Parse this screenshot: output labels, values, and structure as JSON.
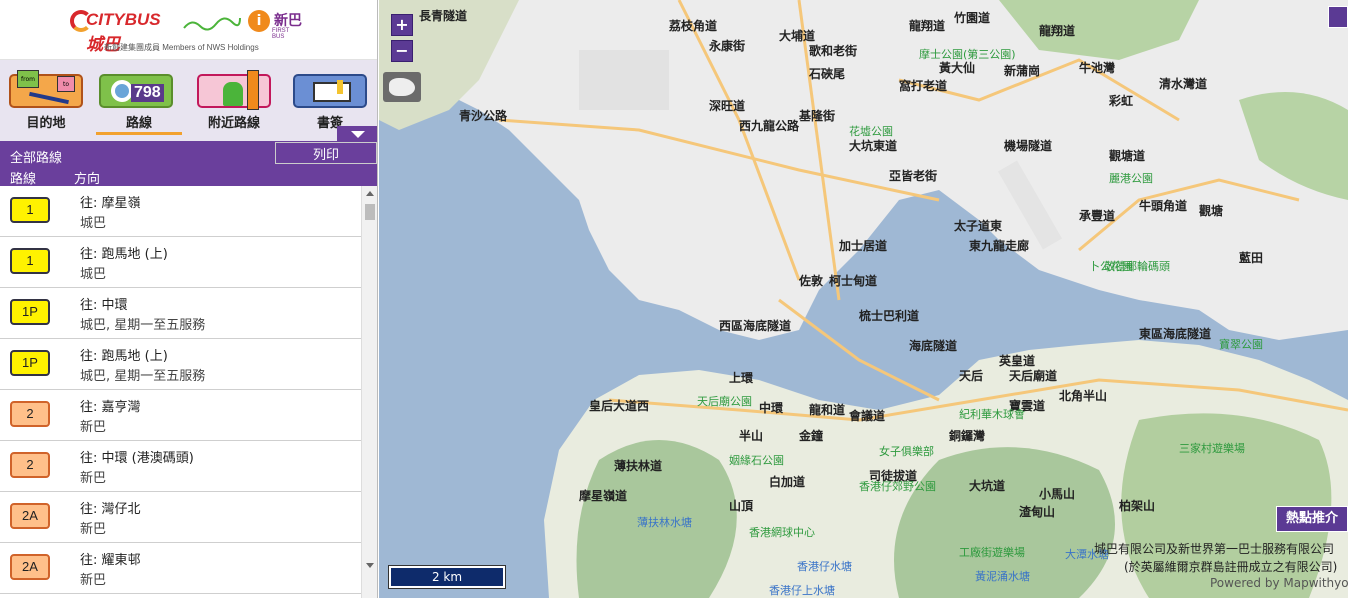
{
  "header": {
    "citybus_logo": "CITYBUS城巴",
    "firstbus_logo": "新巴",
    "firstbus_sub": "FIRST BUS",
    "members": "新創建集團成員 Members of NWS Holdings"
  },
  "nav": {
    "items": [
      {
        "label": "目的地",
        "icon": "from-to-icon"
      },
      {
        "label": "路線",
        "icon": "route-search-icon",
        "number": "798"
      },
      {
        "label": "附近路線",
        "icon": "nearby-icon"
      },
      {
        "label": "書簽",
        "icon": "bookmark-icon"
      }
    ],
    "active": "路線",
    "from_text": "from",
    "to_text": "to"
  },
  "list": {
    "title": "全部路線",
    "print": "列印",
    "col_route": "路線",
    "col_direction": "方向",
    "rows": [
      {
        "route": "1",
        "dir": "往: 摩星嶺",
        "op": "城巴",
        "color": "#fff200"
      },
      {
        "route": "1",
        "dir": "往: 跑馬地 (上)",
        "op": "城巴",
        "color": "#fff200"
      },
      {
        "route": "1P",
        "dir": "往: 中環",
        "op": "城巴, 星期一至五服務",
        "color": "#fff200"
      },
      {
        "route": "1P",
        "dir": "往: 跑馬地 (上)",
        "op": "城巴, 星期一至五服務",
        "color": "#fff200"
      },
      {
        "route": "2",
        "dir": "往: 嘉亨灣",
        "op": "新巴",
        "color": "#ffc08a"
      },
      {
        "route": "2",
        "dir": "往: 中環 (港澳碼頭)",
        "op": "新巴",
        "color": "#ffc08a"
      },
      {
        "route": "2A",
        "dir": "往: 灣仔北",
        "op": "新巴",
        "color": "#ffc08a"
      },
      {
        "route": "2A",
        "dir": "往: 耀東邨",
        "op": "新巴",
        "color": "#ffc08a"
      }
    ]
  },
  "map": {
    "zoom_in": "+",
    "zoom_out": "−",
    "scale": "2 km",
    "hot_button": "熱點推介",
    "copyright_1": "城巴有限公司及新世界第一巴士服務有限公司",
    "copyright_2": "(於英屬維爾京群島註冊成立之有限公司)",
    "powered": "Powered by Mapwithyou",
    "streets": [
      "長青隧道",
      "永康街",
      "大埔道",
      "歌和老街",
      "龍翔道",
      "竹園道",
      "荔枝角道",
      "深旺道",
      "青沙公路",
      "西九龍公路",
      "基隆街",
      "大坑東道",
      "石硤尾",
      "窩打老道",
      "黃大仙",
      "新蒲崗",
      "牛池灣",
      "龍翔道",
      "彩虹",
      "清水灣道",
      "加士居道",
      "亞皆老街",
      "太子道東",
      "機場隧道",
      "觀塘道",
      "承豐道",
      "牛頭角道",
      "觀塘",
      "藍田",
      "柯士甸道",
      "東九龍走廊",
      "西區海底隧道",
      "佐敦",
      "梳士巴利道",
      "海底隧道",
      "東區海底隧道",
      "英皇道",
      "天后廟道",
      "北角半山",
      "皇后大道西",
      "上環",
      "中環",
      "半山",
      "金鐘",
      "龍和道",
      "會議道",
      "天后",
      "銅鑼灣",
      "寶雲道",
      "司徒拔道",
      "白加道",
      "山頂",
      "大坑道",
      "渣甸山",
      "柏架山",
      "小馬山",
      "摩星嶺道",
      "薄扶林道"
    ],
    "parks": [
      "摩士公園(第三公園)",
      "花墟公園",
      "麗港公園",
      "敬德郵輪碼頭",
      "卜公花園",
      "天后廟公園",
      "紀利華木球會",
      "女子俱樂部",
      "姻緣石公園",
      "香港仔郊野公園",
      "香港網球中心",
      "工廠街遊樂場",
      "三家村遊樂場",
      "寶翠公園"
    ],
    "water": [
      "薄扶林水塘",
      "香港仔水塘",
      "大潭水塘",
      "黃泥涌水塘",
      "香港仔上水塘"
    ]
  }
}
